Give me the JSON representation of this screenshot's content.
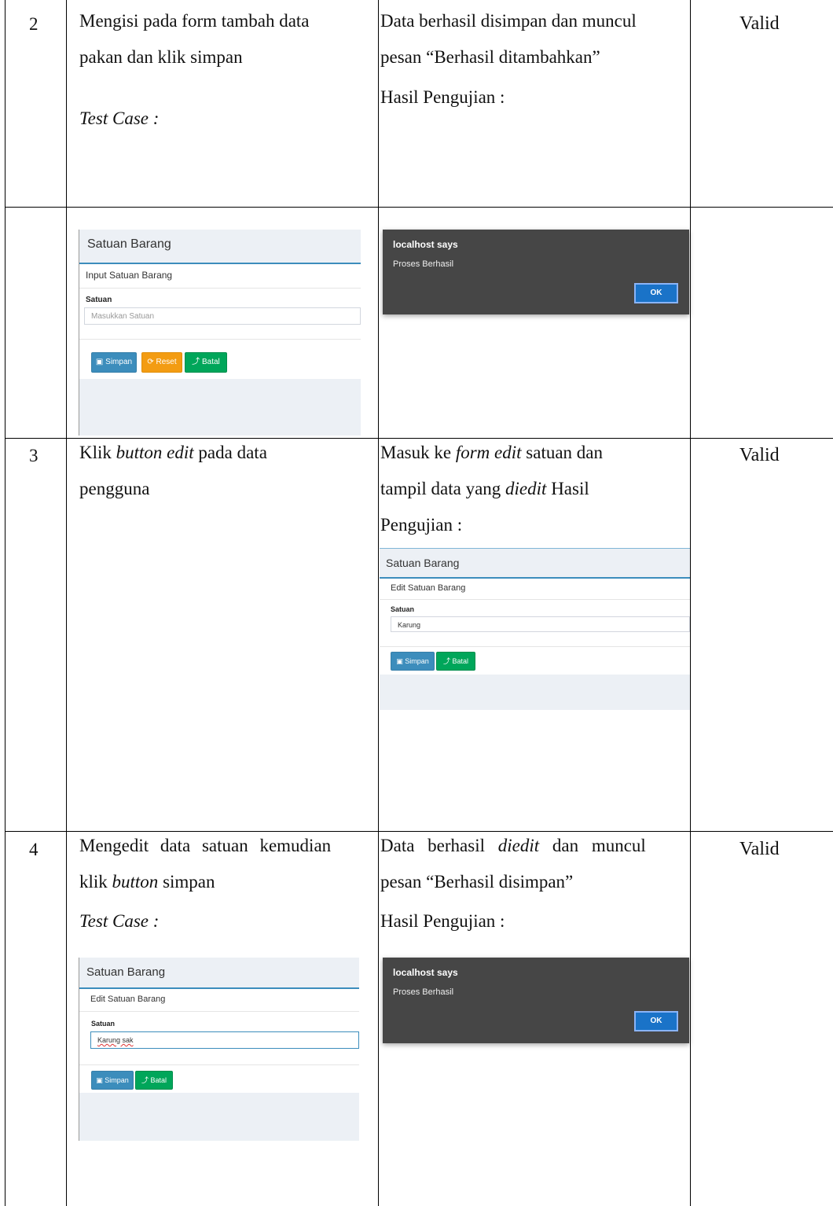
{
  "rows": [
    {
      "no": "2",
      "step_lines": [
        "Mengisi pada form tambah data",
        "pakan dan klik simpan"
      ],
      "step_test_case": "Test Case :",
      "expected_lines": [
        "Data berhasil disimpan dan muncul",
        "pesan “Berhasil ditambahkan”",
        "Hasil Pengujian :"
      ],
      "result": "Valid"
    },
    {
      "no": "3",
      "step_line1_a": "Klik ",
      "step_line1_italic": "button edit",
      "step_line1_b": " pada data",
      "step_line2": "pengguna",
      "expected_line1_a": "Masuk ke ",
      "expected_line1_italic": "form edit",
      "expected_line1_b": " satuan dan",
      "expected_line2_a": "tampil data yang ",
      "expected_line2_italic": "diedit",
      "expected_line2_b": " Hasil",
      "expected_line3": "Pengujian :",
      "result": "Valid"
    },
    {
      "no": "4",
      "step_line1": "Mengedit data satuan kemudian",
      "step_line2_a": "klik ",
      "step_line2_italic": "button",
      "step_line2_b": " simpan",
      "step_test_case": "Test Case :",
      "expected_line1_a": "Data berhasil ",
      "expected_line1_italic": "diedit",
      "expected_line1_b": " dan muncul",
      "expected_line2": "pesan “Berhasil disimpan”",
      "expected_line3": "Hasil Pengujian :",
      "result": "Valid"
    }
  ],
  "form_add": {
    "header": "Satuan Barang",
    "subtitle": "Input Satuan Barang",
    "label": "Satuan",
    "placeholder": "Masukkan Satuan",
    "btn_save": "Simpan",
    "btn_reset": "Reset",
    "btn_cancel": "Batal"
  },
  "form_edit": {
    "header": "Satuan Barang",
    "subtitle": "Edit Satuan Barang",
    "label": "Satuan",
    "value": "Karung",
    "btn_save": "Simpan",
    "btn_cancel": "Batal"
  },
  "form_edit2": {
    "header": "Satuan Barang",
    "subtitle": "Edit Satuan Barang",
    "label": "Satuan",
    "value": "Karung sak",
    "btn_save": "Simpan",
    "btn_cancel": "Batal"
  },
  "dialog": {
    "title": "localhost says",
    "message": "Proses Berhasil",
    "ok": "OK"
  },
  "colors": {
    "primary": "#3c8dbc",
    "warning": "#f39c12",
    "success": "#00a65a",
    "dialog_bg": "#464646",
    "dialog_button": "#1a73c8"
  }
}
